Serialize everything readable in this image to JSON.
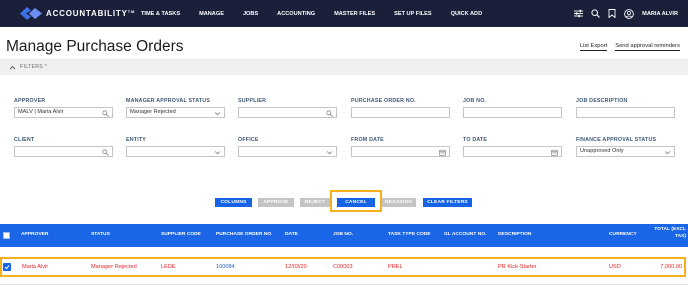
{
  "nav": {
    "brand": "ACCOUNTABILITY",
    "brand_tm": "TM",
    "items": [
      "TIME & TASKS",
      "MANAGE",
      "JOBS",
      "ACCOUNTING",
      "MASTER FILES",
      "SET UP FILES",
      "QUICK ADD"
    ],
    "user_name": "MARIA ALVIR",
    "icons": [
      "sliders-icon",
      "search-icon",
      "bookmark-icon",
      "user-circle-icon"
    ]
  },
  "page": {
    "title": "Manage Purchase Orders",
    "links": [
      "List Export",
      "Send approval reminders"
    ],
    "filters_toggle": "FILTERS *"
  },
  "filters": {
    "approver": {
      "label": "APPROVER",
      "value": "MALV | Maria Alvir"
    },
    "manager_approval_status": {
      "label": "MANAGER APPROVAL STATUS",
      "value": "Manager Rejected"
    },
    "supplier": {
      "label": "SUPPLIER",
      "value": ""
    },
    "purchase_order_no": {
      "label": "PURCHASE ORDER NO.",
      "value": ""
    },
    "job_no": {
      "label": "JOB NO.",
      "value": ""
    },
    "job_description": {
      "label": "JOB DESCRIPTION",
      "value": ""
    },
    "client": {
      "label": "CLIENT",
      "value": ""
    },
    "entity": {
      "label": "ENTITY",
      "value": ""
    },
    "office": {
      "label": "OFFICE",
      "value": ""
    },
    "from_date": {
      "label": "FROM DATE",
      "value": ""
    },
    "to_date": {
      "label": "TO DATE",
      "value": ""
    },
    "finance_approval_status": {
      "label": "FINANCE APPROVAL STATUS",
      "value": "Unapproved Only"
    }
  },
  "actions": {
    "columns": "COLUMNS",
    "approve": "APPROVE",
    "reject": "REJECT",
    "cancel": "CANCEL",
    "reassign": "REASSIGN",
    "clear_filters": "CLEAR FILTERS"
  },
  "table": {
    "headers": {
      "approver": "APPROVER",
      "status": "STATUS",
      "supplier_code": "SUPPLIER CODE",
      "po_no": "PURCHASE ORDER NO.",
      "date": "DATE",
      "job_no": "JOB NO.",
      "task_type_code": "TASK TYPE CODE",
      "gl_account_no": "GL ACCOUNT NO.",
      "description": "DESCRIPTION",
      "currency": "CURRENCY",
      "total_line1": "TOTAL (EXCL",
      "total_line2": "TAX)"
    },
    "rows": [
      {
        "checked": true,
        "approver": "Maria Alvir",
        "status": "Manager Rejected",
        "supplier_code": "LEDE",
        "po_no": "100084",
        "date": "12/03/20",
        "job_no": "C00003",
        "task_type_code": "PREL",
        "gl_account_no": "",
        "description": "PR Kick-Starter",
        "currency": "USD",
        "total": "7,000.00"
      }
    ]
  },
  "colors": {
    "nav_bg": "#1a1f3a",
    "accent_blue": "#1b66e6",
    "highlight": "#f5b020",
    "row_text_red": "#e3262a",
    "row_text_blue": "#2460c8",
    "label_blue": "#3f5876"
  }
}
